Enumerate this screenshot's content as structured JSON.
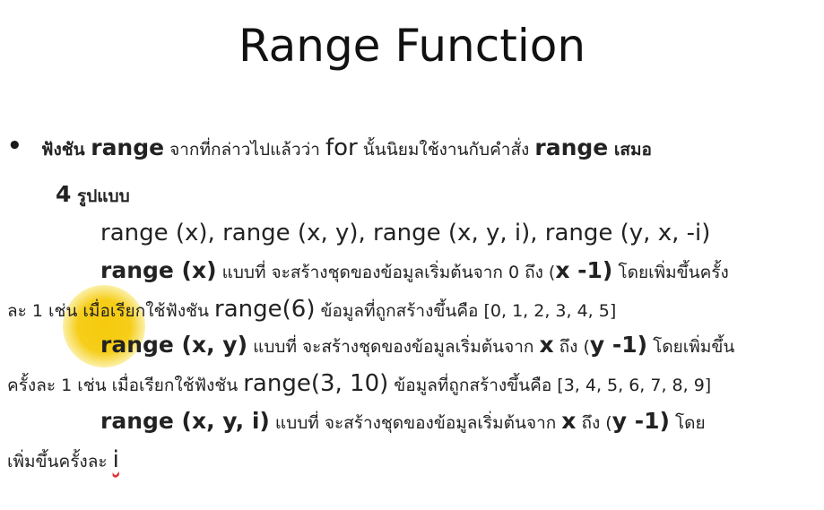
{
  "slide": {
    "title": "Range Function",
    "bullet": "•",
    "line1": {
      "a": "ฟังชัน ",
      "b": "range",
      "c": " จากที่กล่าวไปแล้วว่า ",
      "d": "for",
      "e": " นั้นนิยมใช้งานกับคำสั่ง ",
      "f": "range",
      "g": " เสมอ"
    },
    "line2": {
      "a": "4",
      "b": " รูปแบบ"
    },
    "line3": "range (x), range (x, y), range (x, y, i), range (y, x, -i)",
    "line4": {
      "a": "range (x)",
      "b": " แบบที่  จะสร้างชุดของข้อมูลเริ่มต้นจาก 0 ถึง (",
      "c": "x -1)",
      "d": " โดยเพิ่มขึ้นครั้ง"
    },
    "line5": {
      "a": "ละ 1 เช่น เมื่อเรียกใช้ฟังชัน ",
      "b": "range(6)",
      "c": " ข้อมูลที่ถูกสร้างขึ้นคือ [0, 1, 2, 3, 4, 5]"
    },
    "line6": {
      "a": "range (x, y)",
      "b": " แบบที่  จะสร้างชุดของข้อมูลเริ่มต้นจาก ",
      "c": "x",
      "d": " ถึง (",
      "e": "y -1)",
      "f": " โดยเพิ่มขึ้น"
    },
    "line7": {
      "a": "ครั้งละ 1 เช่น เมื่อเรียกใช้ฟังชัน ",
      "b": "range(3, 10)",
      "c": " ข้อมูลที่ถูกสร้างขึ้นคือ [3, 4, 5, 6, 7, 8, 9]"
    },
    "line8": {
      "a": "range (x, y, i)",
      "b": " แบบที่  จะสร้างชุดของข้อมูลเริ่มต้นจาก ",
      "c": "x",
      "d": " ถึง (",
      "e": "y -1)",
      "f": " โดย"
    },
    "line9": {
      "a": "เพิ่มขึ้นครั้งละ ",
      "b": "i"
    }
  },
  "colors": {
    "highlight": "#f5c800",
    "text": "#222222",
    "spell_underline": "#dd3333"
  }
}
